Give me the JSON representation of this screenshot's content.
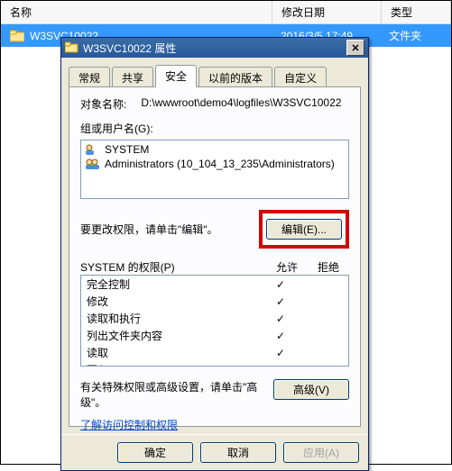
{
  "explorer": {
    "cols": {
      "name": "名称",
      "date": "修改日期",
      "type": "类型"
    },
    "row": {
      "name": "W3SVC10022",
      "date": "2016/3/5 17:49",
      "type": "文件夹"
    }
  },
  "dialog": {
    "title": "W3SVC10022 属性",
    "tabs": {
      "general": "常规",
      "share": "共享",
      "security": "安全",
      "prev": "以前的版本",
      "custom": "自定义"
    },
    "objectLabel": "对象名称:",
    "objectValue": "D:\\wwwroot\\demo4\\logfiles\\W3SVC10022",
    "groupLabel": "组或用户名(G):",
    "groups": [
      {
        "name": "SYSTEM"
      },
      {
        "name": "Administrators (10_104_13_235\\Administrators)"
      }
    ],
    "editHint": "要更改权限，请单击\"编辑\"。",
    "editBtn": "编辑(E)...",
    "permHeader": "SYSTEM 的权限(P)",
    "allow": "允许",
    "deny": "拒绝",
    "perms": [
      {
        "label": "完全控制",
        "allow": true,
        "deny": false
      },
      {
        "label": "修改",
        "allow": true,
        "deny": false
      },
      {
        "label": "读取和执行",
        "allow": true,
        "deny": false
      },
      {
        "label": "列出文件夹内容",
        "allow": true,
        "deny": false
      },
      {
        "label": "读取",
        "allow": true,
        "deny": false
      },
      {
        "label": "写入",
        "allow": true,
        "deny": false
      }
    ],
    "advHint": "有关特殊权限或高级设置，请单击\"高级\"。",
    "advBtn": "高级(V)",
    "link": "了解访问控制和权限",
    "ok": "确定",
    "cancel": "取消",
    "apply": "应用(A)"
  }
}
